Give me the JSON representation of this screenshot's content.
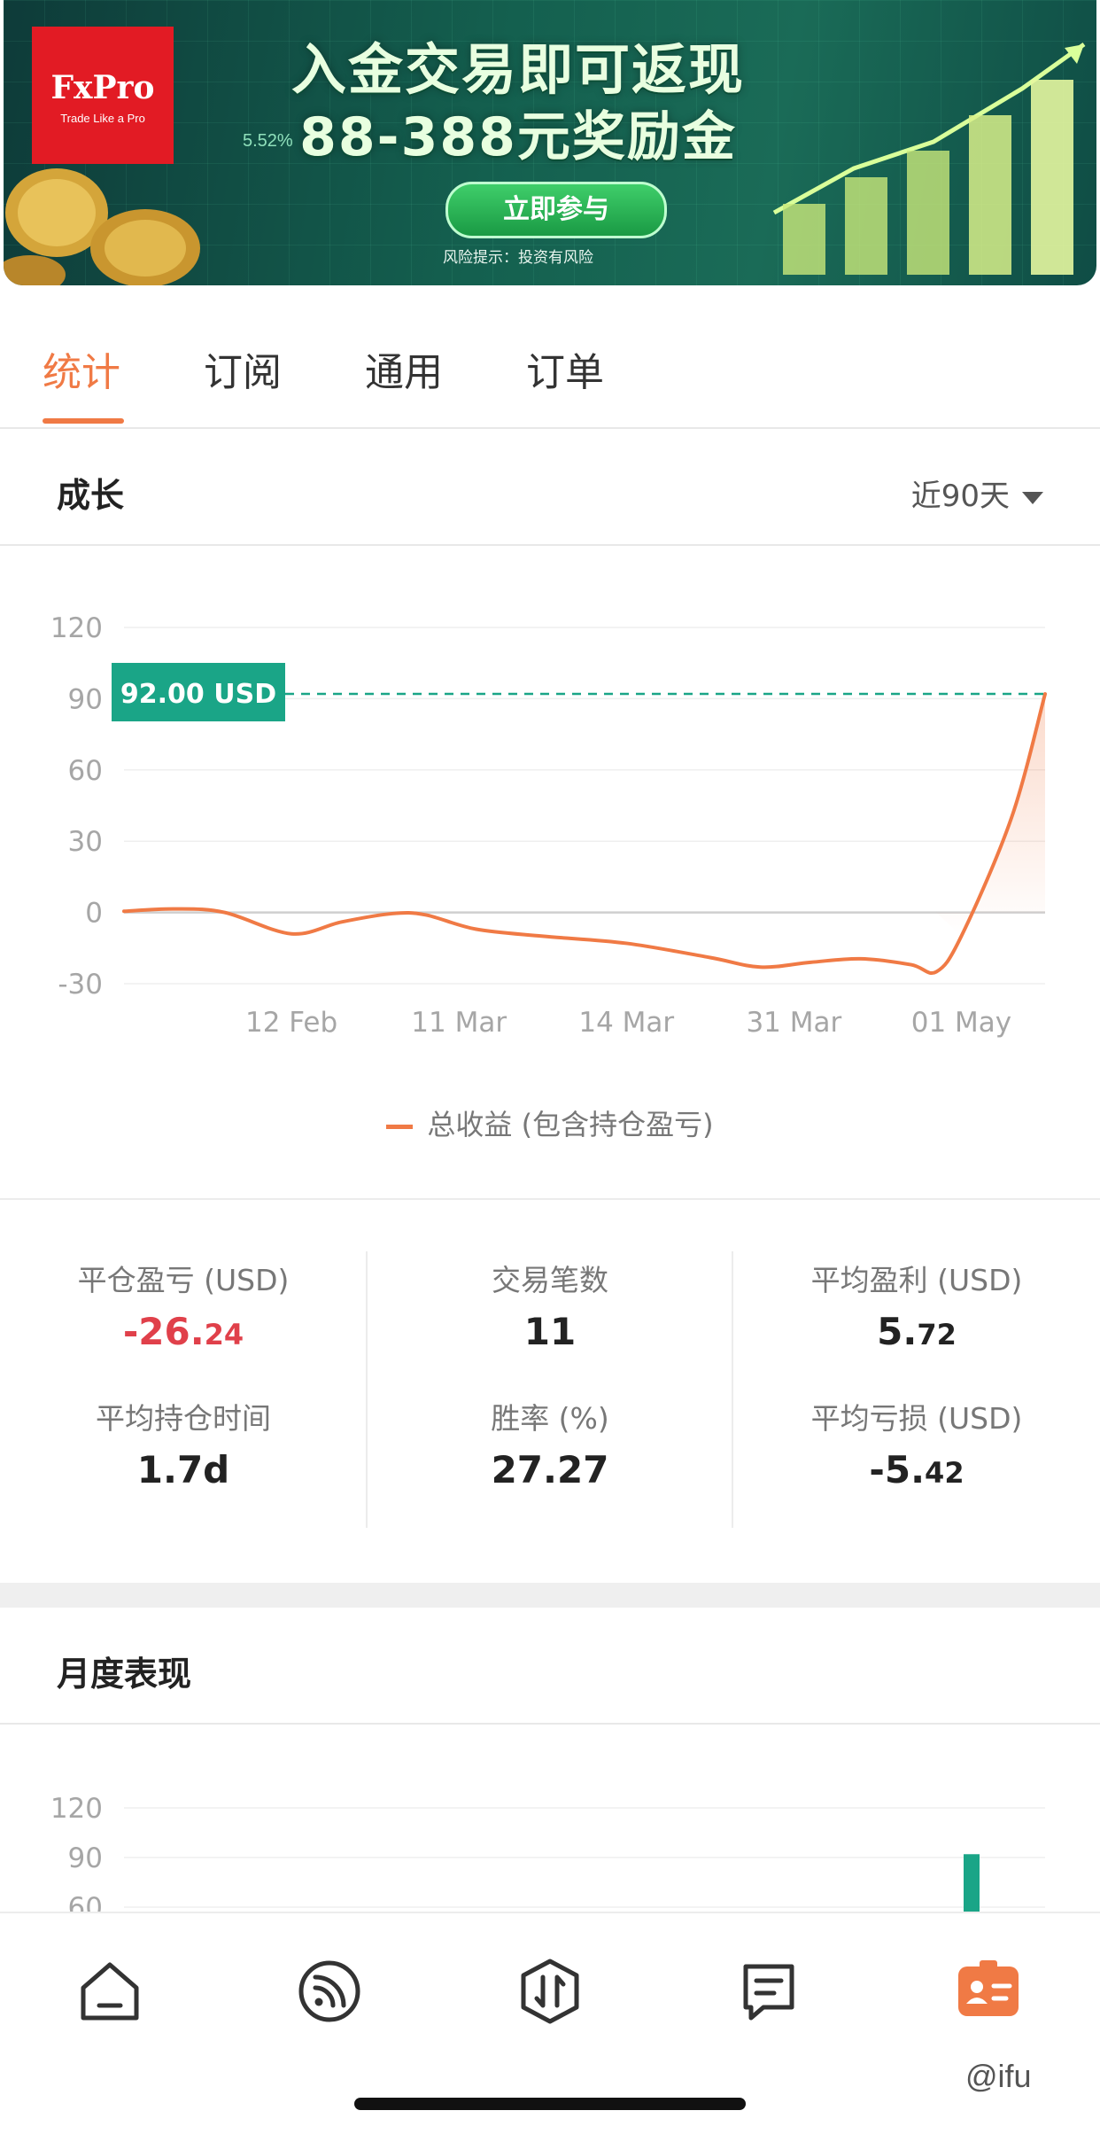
{
  "banner": {
    "brand_name": "FxPro",
    "brand_tagline": "Trade Like a Pro",
    "percent_text": "5.52%",
    "headline_1": "入金交易即可返现",
    "headline_2": "88-388元奖励金",
    "cta_label": "立即参与",
    "risk_notice": "风险提示：投资有风险"
  },
  "tabs": [
    {
      "label": "统计",
      "active": true
    },
    {
      "label": "订阅",
      "active": false
    },
    {
      "label": "通用",
      "active": false
    },
    {
      "label": "订单",
      "active": false
    }
  ],
  "growth": {
    "title": "成长",
    "range_label": "近90天",
    "current_label": "92.00 USD",
    "legend": "总收益 (包含持仓盈亏)"
  },
  "chart_data": [
    {
      "type": "line",
      "title": "",
      "xlabel": "",
      "ylabel": "",
      "ylim": [
        -30,
        120
      ],
      "yticks": [
        120,
        90,
        60,
        30,
        0,
        -30
      ],
      "xtick_labels": [
        "12 Feb",
        "11 Mar",
        "14 Mar",
        "31 Mar",
        "01 May"
      ],
      "grid": true,
      "series": [
        {
          "name": "总收益 (包含持仓盈亏)",
          "color": "#f07a45",
          "points": [
            {
              "i": 0,
              "y": 0.5
            },
            {
              "i": 0.3,
              "y": 1.5
            },
            {
              "i": 0.6,
              "y": 0
            },
            {
              "i": 1.0,
              "y": -9
            },
            {
              "i": 1.3,
              "y": -4
            },
            {
              "i": 1.6,
              "y": -0.5
            },
            {
              "i": 1.8,
              "y": -1
            },
            {
              "i": 2.1,
              "y": -7
            },
            {
              "i": 2.5,
              "y": -10
            },
            {
              "i": 3.0,
              "y": -13
            },
            {
              "i": 3.5,
              "y": -19
            },
            {
              "i": 3.8,
              "y": -23
            },
            {
              "i": 4.1,
              "y": -21
            },
            {
              "i": 4.4,
              "y": -19.5
            },
            {
              "i": 4.7,
              "y": -22
            },
            {
              "i": 4.85,
              "y": -25
            },
            {
              "i": 5.0,
              "y": -10
            },
            {
              "i": 5.3,
              "y": 40
            },
            {
              "i": 5.5,
              "y": 92
            }
          ]
        }
      ],
      "reference_line": {
        "y": 92,
        "color": "#1aa587"
      }
    },
    {
      "type": "bar",
      "title": "月度表现",
      "ylim": [
        30,
        120
      ],
      "yticks": [
        120,
        90,
        60
      ],
      "series": [
        {
          "color": "#1aa587",
          "values": [
            92
          ]
        }
      ]
    }
  ],
  "stats": [
    {
      "label": "平仓盈亏 (USD)",
      "value_int": "-26.",
      "value_dec": "24",
      "negative": true
    },
    {
      "label": "交易笔数",
      "value_int": "11",
      "value_dec": "",
      "negative": false
    },
    {
      "label": "平均盈利 (USD)",
      "value_int": "5.",
      "value_dec": "72",
      "negative": false
    },
    {
      "label": "平均持仓时间",
      "value_int": "1.7d",
      "value_dec": "",
      "negative": false
    },
    {
      "label": "胜率 (%)",
      "value_int": "27.27",
      "value_dec": "",
      "negative": false
    },
    {
      "label": "平均亏损 (USD)",
      "value_int": "-5.",
      "value_dec": "42",
      "negative": false
    }
  ],
  "monthly": {
    "title": "月度表现"
  },
  "bottom_nav": [
    {
      "name": "home-icon",
      "active": false
    },
    {
      "name": "feed-icon",
      "active": false
    },
    {
      "name": "trade-icon",
      "active": false
    },
    {
      "name": "orders-icon",
      "active": false
    },
    {
      "name": "profile-card-icon",
      "active": true
    }
  ],
  "accent_color": "#f07a45",
  "positive_color": "#1aa587",
  "watermark": "@ifu"
}
